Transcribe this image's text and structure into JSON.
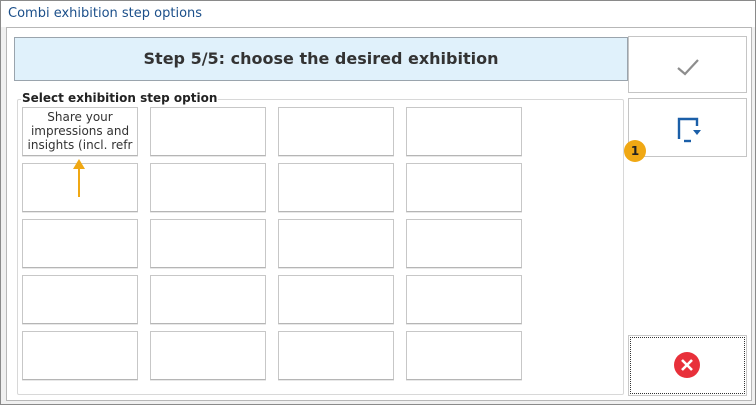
{
  "window": {
    "title": "Combi exhibition step options"
  },
  "header": {
    "step_text": "Step 5/5: choose the desired exhibition"
  },
  "group": {
    "label": "Select exhibition step option"
  },
  "grid": {
    "cells": [
      "Share your impressions and insights (incl. refr",
      "",
      "",
      "",
      "",
      "",
      "",
      "",
      "",
      "",
      "",
      "",
      "",
      "",
      "",
      "",
      "",
      "",
      "",
      ""
    ]
  },
  "annotation": {
    "badge": "1"
  },
  "colors": {
    "accent_blue": "#1b5fa8",
    "header_bg": "#e0f1fb",
    "badge": "#f0a814",
    "cancel_red": "#e8303a"
  },
  "icons": {
    "confirm": "check-icon",
    "export": "export-icon",
    "cancel": "cancel-icon"
  }
}
